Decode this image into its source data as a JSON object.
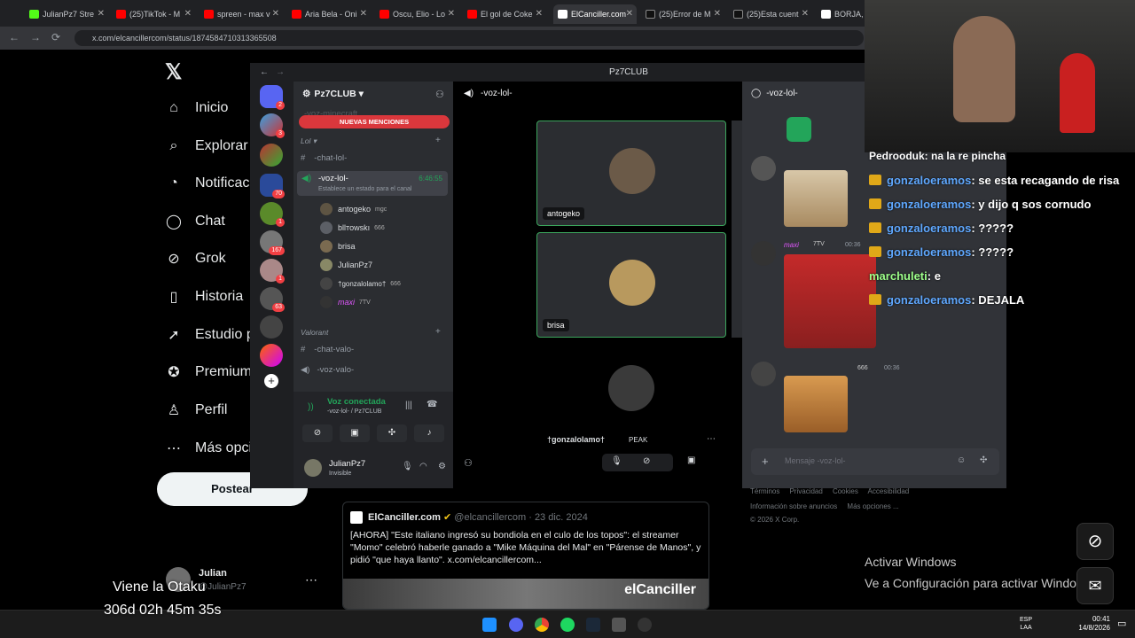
{
  "browser": {
    "tabs": [
      "JulianPz7 Stre",
      "(25)TikTok - M",
      "spreen - max v",
      "Aria Bela - Oni",
      "Oscu, Elio - Lo",
      "El gol de Coke",
      "ElCanciller.com",
      "(25)Error de M",
      "(25)Esta cuent",
      "BORJA, LE"
    ],
    "active_tab": 6,
    "url": "x.com/elcancillercom/status/1874584710313365508"
  },
  "x_sidebar": {
    "items": [
      "Inicio",
      "Explorar",
      "Notificaciones",
      "Chat",
      "Grok",
      "Historia",
      "Estudio p",
      "Premium",
      "Perfil",
      "Más opci"
    ],
    "post_label": "Postear",
    "profile_name": "Julian",
    "profile_handle": "@JulianPz7"
  },
  "overlay_text": {
    "line1": "Viene la Otaku",
    "line2": "306d 02h 45m 35s"
  },
  "discord": {
    "window_title": "Pz7CLUB",
    "server_name": "Pz7CLUB",
    "server_badges": [
      "2",
      "3",
      "",
      "70",
      "1",
      "167",
      "1",
      "63"
    ],
    "new_mentions": "NUEVAS MENCIONES",
    "faded_channel": "-voz-minecraft",
    "cat_lol": "Lol",
    "chat_lol": "-chat-lol-",
    "voice_lol": "-voz-lol-",
    "voice_timer": "6:46:55",
    "status_hint": "Establece un estado para el canal",
    "voice_users": [
      {
        "name": "antogeko",
        "tag": "mgc"
      },
      {
        "name": "bllтowskı",
        "tag": "666"
      },
      {
        "name": "brisa",
        "tag": ""
      },
      {
        "name": "JulianPz7",
        "tag": ""
      },
      {
        "name": "†gonzalolamo†",
        "tag": "666"
      },
      {
        "name": "maxi",
        "tag": "7TV"
      }
    ],
    "cat_valorant": "Valorant",
    "chat_valo": "-chat-valo-",
    "voice_valo": "-voz-valo-",
    "voice_connected": "Voz conectada",
    "voice_connected_sub": "-voz-lol- / Pz7CLUB",
    "user_name": "JulianPz7",
    "user_status": "Invisible",
    "vid_header": "-voz-lol-",
    "tiles": [
      {
        "label": "antogeko"
      },
      {
        "label": "brisa"
      },
      {
        "label": "†gonzalolamo†"
      }
    ],
    "peak_label": "PEAK",
    "chat_header": "-voz-lol-",
    "messages": [
      {
        "time": "00:36",
        "author": "maxi",
        "tag": "7TV"
      },
      {
        "time": "00:36",
        "author": "",
        "tag": "666"
      }
    ],
    "message_placeholder": "Mensaje -voz-lol-"
  },
  "stream_chat": [
    {
      "user": "Pedrooduk",
      "msg": ": na la re pincha",
      "color": "#ffffff"
    },
    {
      "user": "gonzaloeramos",
      "msg": ": se esta recagando de risa",
      "color": "#5fa8ff"
    },
    {
      "user": "gonzaloeramos",
      "msg": ": y dijo q sos cornudo",
      "color": "#5fa8ff"
    },
    {
      "user": "gonzaloeramos",
      "msg": ": ?????",
      "color": "#5fa8ff"
    },
    {
      "user": "gonzaloeramos",
      "msg": ": ?????",
      "color": "#5fa8ff"
    },
    {
      "user": "marchuleti",
      "msg": ": e",
      "color": "#9dff8a"
    },
    {
      "user": "gonzaloeramos",
      "msg": ": DEJALA",
      "color": "#5fa8ff"
    }
  ],
  "tweet": {
    "name": "ElCanciller.com",
    "handle": "@elcancillercom",
    "date": "23 dic. 2024",
    "text": "[AHORA] \"Este italiano ingresó su bondiola en el culo de los topos\": el streamer \"Momo\" celebró haberle ganado a \"Mike Máquina del Mal\" en \"Párense de Manos\", y pidió \"que haya llanto\".  x.com/elcancillercom...",
    "image_text": "elCanciller"
  },
  "footer_links": [
    "Términos",
    "Privacidad",
    "Cookies",
    "Accesibilidad",
    "Información sobre anuncios",
    "Más opciones ...",
    "© 2026 X Corp."
  ],
  "windows_activation": {
    "title": "Activar Windows",
    "subtitle": "Ve a Configuración para activar Windows."
  },
  "taskbar": {
    "lang1": "ESP",
    "lang2": "LAA",
    "time": "00:41",
    "date": "14/8/2026"
  },
  "colors": {
    "discord_accent": "#5865f2",
    "x_blue": "#1d9bf0",
    "mention_red": "#f23f43"
  }
}
